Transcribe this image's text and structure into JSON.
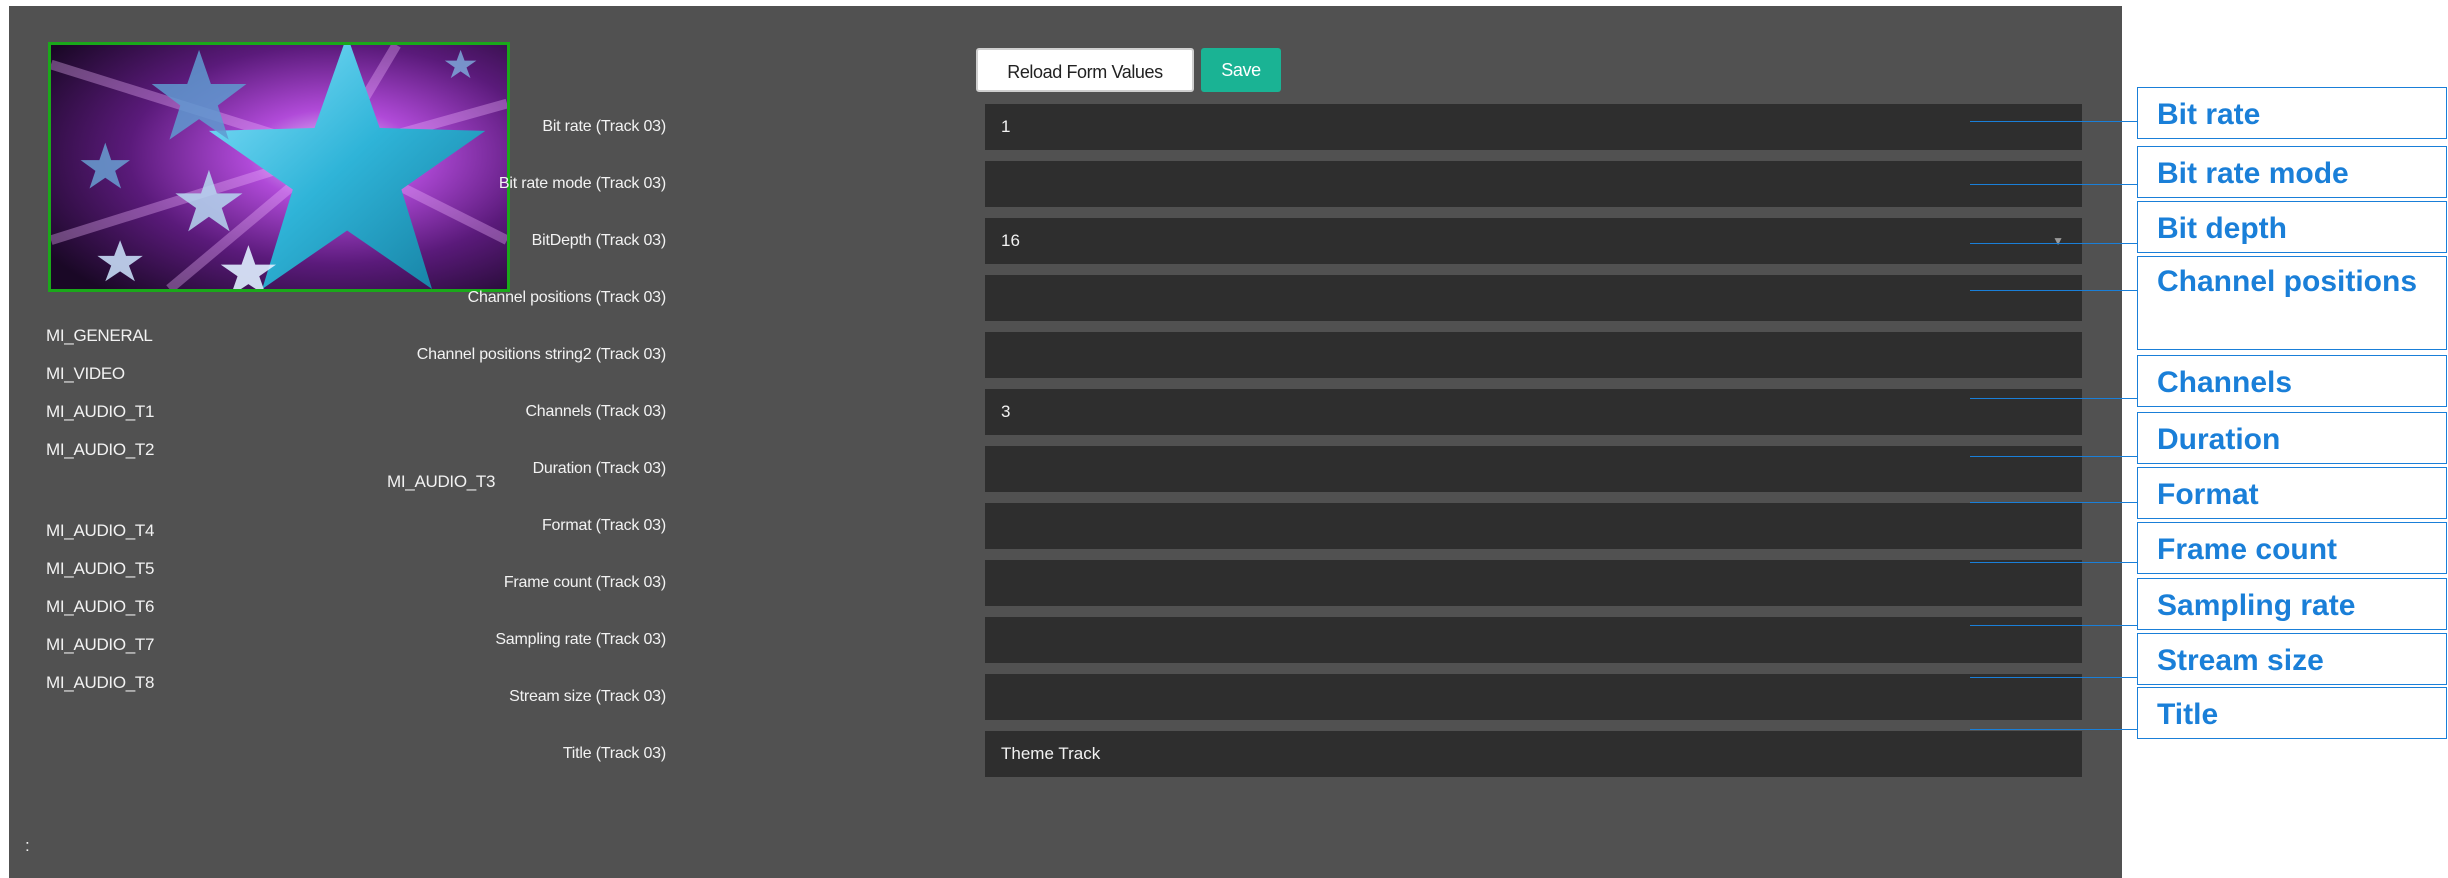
{
  "buttons": {
    "reload": "Reload Form Values",
    "save": "Save"
  },
  "nav": {
    "items_before": [
      "MI_GENERAL",
      "MI_VIDEO",
      "MI_AUDIO_T1",
      "MI_AUDIO_T2"
    ],
    "current": "MI_AUDIO_T3",
    "items_after": [
      "MI_AUDIO_T4",
      "MI_AUDIO_T5",
      "MI_AUDIO_T6",
      "MI_AUDIO_T7",
      "MI_AUDIO_T8"
    ]
  },
  "footer": {
    "colon": ":"
  },
  "fields": [
    {
      "label": "Bit rate (Track 03)",
      "value": "1"
    },
    {
      "label": "Bit rate mode (Track 03)",
      "value": ""
    },
    {
      "label": "BitDepth (Track 03)",
      "value": "16",
      "type": "select"
    },
    {
      "label": "Channel positions (Track 03)",
      "value": ""
    },
    {
      "label": "Channel positions string2 (Track 03)",
      "value": ""
    },
    {
      "label": "Channels (Track 03)",
      "value": "3"
    },
    {
      "label": "Duration (Track 03)",
      "value": ""
    },
    {
      "label": "Format (Track 03)",
      "value": ""
    },
    {
      "label": "Frame count (Track 03)",
      "value": ""
    },
    {
      "label": "Sampling rate (Track 03)",
      "value": ""
    },
    {
      "label": "Stream size (Track 03)",
      "value": ""
    },
    {
      "label": "Title (Track 03)",
      "value": "Theme Track"
    }
  ],
  "callouts": [
    "Bit rate",
    "Bit rate mode",
    "Bit depth",
    "Channel positions",
    "Channels",
    "Duration",
    "Format",
    "Frame count",
    "Sampling rate",
    "Stream size",
    "Title"
  ],
  "colors": {
    "panel": "#515151",
    "field": "#2e2e2e",
    "save": "#1ab394",
    "thumb_border": "#1aa81a",
    "callout": "#1a7fd8"
  }
}
